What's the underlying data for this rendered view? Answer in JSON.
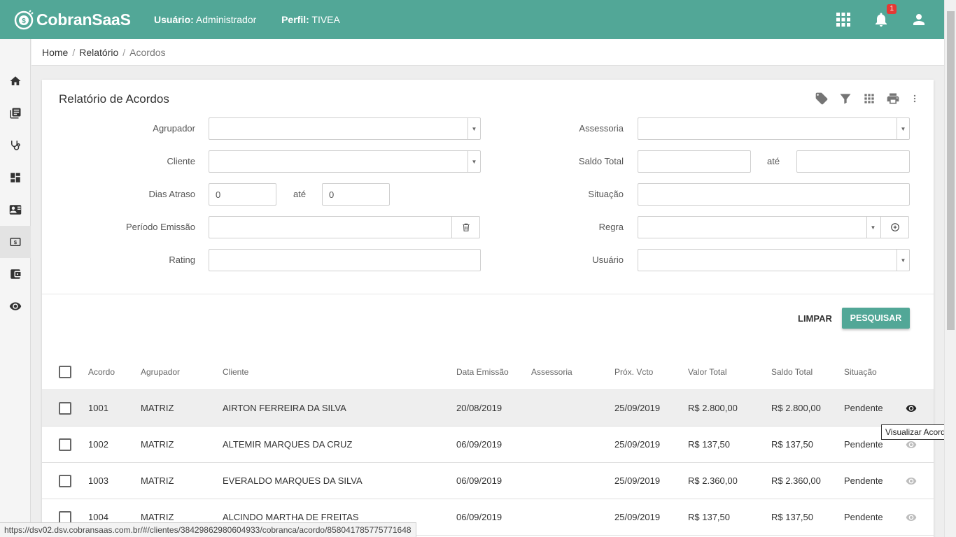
{
  "header": {
    "brand": "CobranSaaS",
    "user_label": "Usuário:",
    "user_value": "Administrador",
    "profile_label": "Perfil:",
    "profile_value": "TIVEA",
    "notification_count": "1",
    "icons": [
      "apps-grid-icon",
      "bell-icon",
      "account-icon"
    ],
    "bg_color": "#52a797"
  },
  "sidebar": {
    "items": [
      "home-icon",
      "library-books-icon",
      "stethoscope-icon",
      "dashboard-icon",
      "contact-card-icon",
      "money-icon",
      "wallet-icon",
      "eye-icon"
    ],
    "active_index": 5
  },
  "breadcrumb": {
    "home": "Home",
    "relatorio": "Relatório",
    "current": "Acordos"
  },
  "card": {
    "title": "Relatório de Acordos",
    "tools": [
      "tag-icon",
      "filter-icon",
      "grid-icon",
      "print-icon",
      "more-vert-icon"
    ]
  },
  "filters": {
    "agrupador_label": "Agrupador",
    "cliente_label": "Cliente",
    "dias_atraso_label": "Dias Atraso",
    "dias_atraso_from": "0",
    "dias_atraso_to": "0",
    "ate": "até",
    "periodo_label": "Período Emissão",
    "rating_label": "Rating",
    "assessoria_label": "Assessoria",
    "saldo_label": "Saldo Total",
    "situacao_label": "Situação",
    "regra_label": "Regra",
    "usuario_label": "Usuário"
  },
  "actions": {
    "clear": "LIMPAR",
    "search": "PESQUISAR"
  },
  "table": {
    "columns": [
      "Acordo",
      "Agrupador",
      "Cliente",
      "Data Emissão",
      "Assessoria",
      "Próx. Vcto",
      "Valor Total",
      "Saldo Total",
      "Situação"
    ],
    "rows": [
      {
        "acordo": "1001",
        "agrupador": "MATRIZ",
        "cliente": "AIRTON FERREIRA DA SILVA",
        "emissao": "20/08/2019",
        "assessoria": "",
        "vcto": "25/09/2019",
        "valor": "R$ 2.800,00",
        "saldo": "R$ 2.800,00",
        "situacao": "Pendente"
      },
      {
        "acordo": "1002",
        "agrupador": "MATRIZ",
        "cliente": "ALTEMIR MARQUES DA CRUZ",
        "emissao": "06/09/2019",
        "assessoria": "",
        "vcto": "25/09/2019",
        "valor": "R$ 137,50",
        "saldo": "R$ 137,50",
        "situacao": "Pendente"
      },
      {
        "acordo": "1003",
        "agrupador": "MATRIZ",
        "cliente": "EVERALDO MARQUES DA SILVA",
        "emissao": "06/09/2019",
        "assessoria": "",
        "vcto": "25/09/2019",
        "valor": "R$ 2.360,00",
        "saldo": "R$ 2.360,00",
        "situacao": "Pendente"
      },
      {
        "acordo": "1004",
        "agrupador": "MATRIZ",
        "cliente": "ALCINDO MARTHA DE FREITAS",
        "emissao": "06/09/2019",
        "assessoria": "",
        "vcto": "25/09/2019",
        "valor": "R$ 137,50",
        "saldo": "R$ 137,50",
        "situacao": "Pendente"
      }
    ]
  },
  "tooltip": "Visualizar Acordo",
  "status_url": "https://dsv02.dsv.cobransaas.com.br/#/clientes/38429862980604933/cobranca/acordo/858041785775771648"
}
